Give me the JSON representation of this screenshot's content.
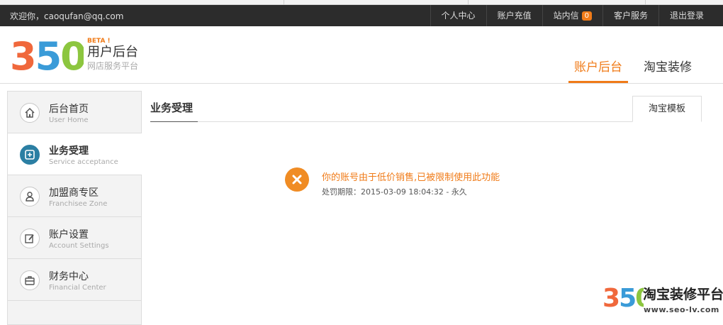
{
  "topbar": {
    "welcome": "欢迎你，caoqufan@qq.com",
    "nav": {
      "personal": "个人中心",
      "recharge": "账户充值",
      "messages": "站内信",
      "message_count": "0",
      "service": "客户服务",
      "logout": "退出登录"
    }
  },
  "header": {
    "logo_text": "350",
    "beta": "BETA !",
    "brand": "用户后台",
    "subtitle": "网店服务平台",
    "tabs": [
      "账户后台",
      "淘宝装修"
    ]
  },
  "sidebar": {
    "items": [
      {
        "label": "后台首页",
        "sub": "User Home"
      },
      {
        "label": "业务受理",
        "sub": "Service acceptance"
      },
      {
        "label": "加盟商专区",
        "sub": "Franchisee Zone"
      },
      {
        "label": "账户设置",
        "sub": "Account Settings"
      },
      {
        "label": "财务中心",
        "sub": "Financial Center"
      }
    ]
  },
  "main": {
    "section_title": "业务受理",
    "template_button": "淘宝模板",
    "error_message": "你的账号由于低价销售,已被限制使用此功能",
    "penalty": "处罚期限：2015-03-09 18:04:32 - 永久"
  },
  "watermark": {
    "logo_text": "350",
    "title": "淘宝装修平台",
    "url": "www.seo-lv.com"
  },
  "colors": {
    "accent": "#f07b18",
    "topbar": "#2c2c2c",
    "active_icon": "#2b7fa3",
    "logo_orange": "#f0683c",
    "logo_blue": "#3a9bd8",
    "logo_green": "#8cc63f"
  }
}
